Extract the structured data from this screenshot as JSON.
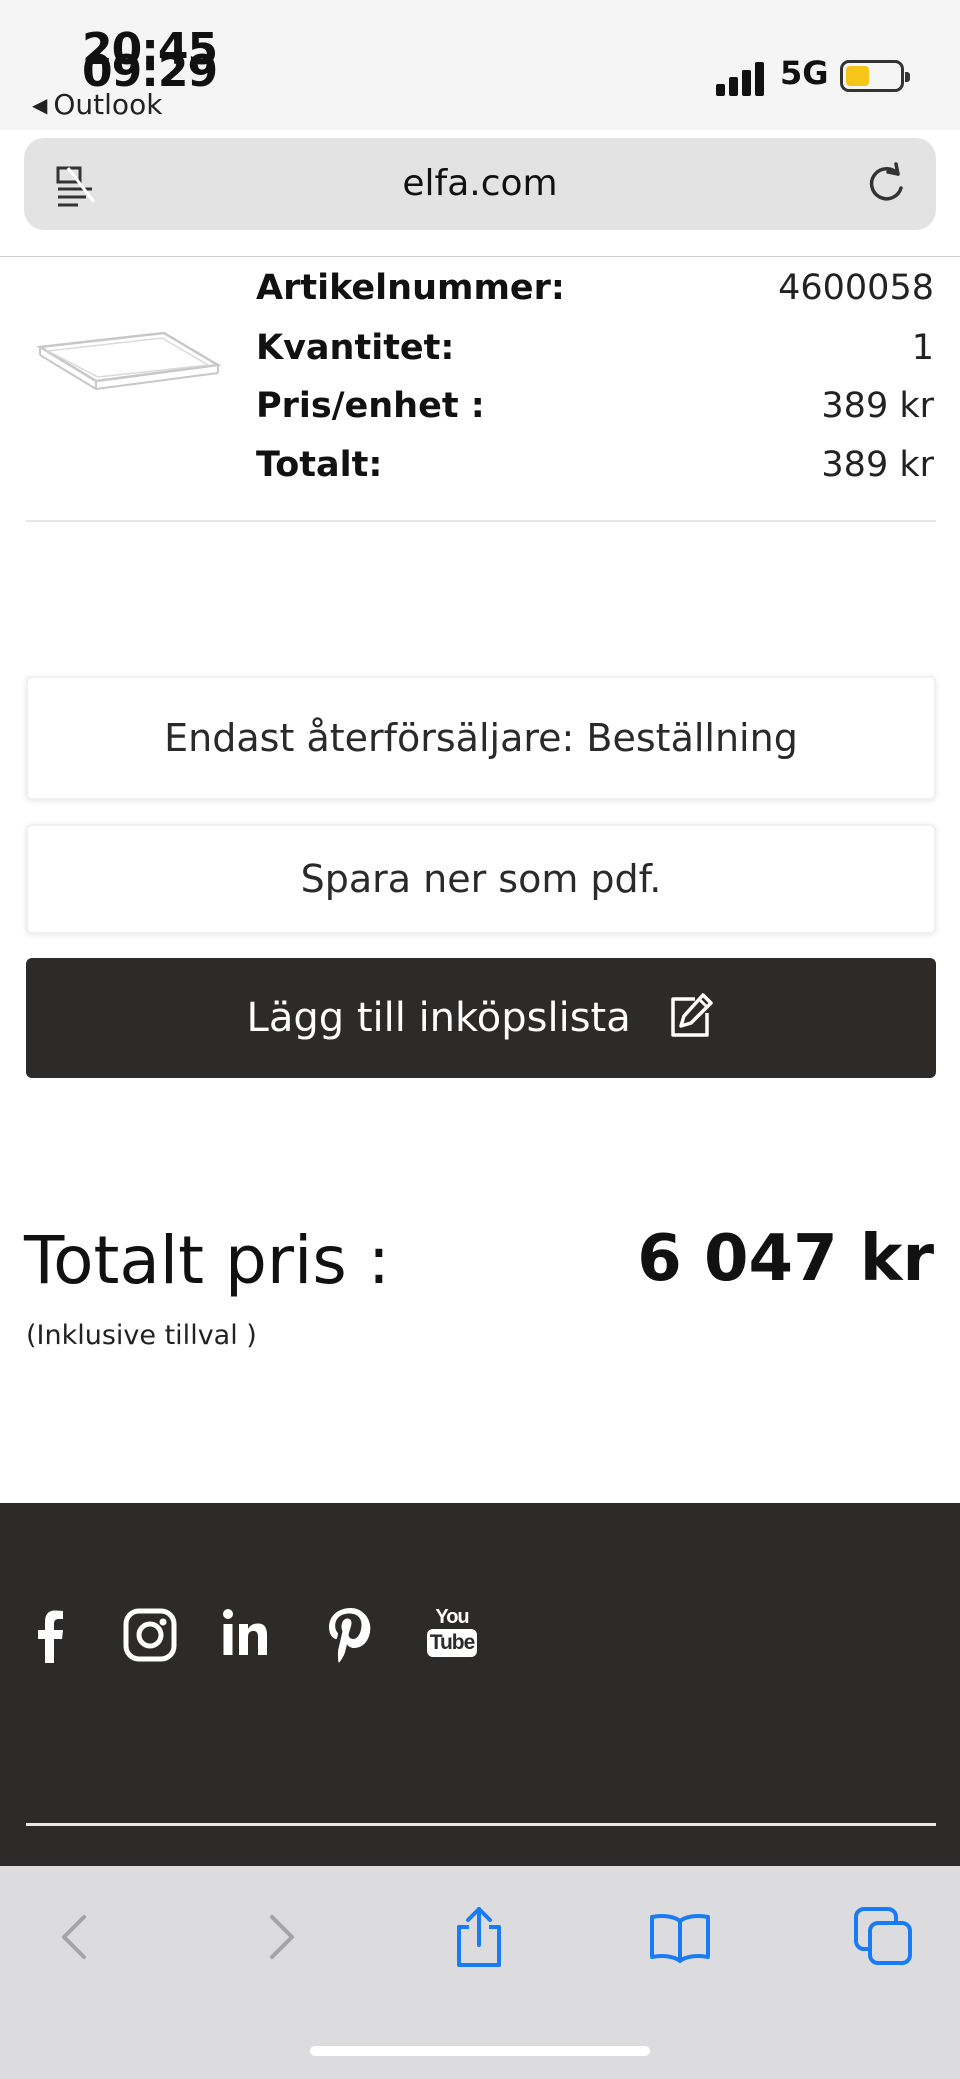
{
  "status_bar": {
    "time_primary": "20:45",
    "time_secondary": "09:29",
    "back_app": "Outlook",
    "network": "5G",
    "battery_level": 0.45
  },
  "browser": {
    "url": "elfa.com",
    "left_icon": "reader-icon",
    "reload_icon": "reload-icon"
  },
  "article": {
    "rows": [
      {
        "label": "Artikelnummer:",
        "value": "4600058"
      },
      {
        "label": "Kvantitet:",
        "value": "1"
      },
      {
        "label": "Pris/enhet :",
        "value": "389 kr"
      },
      {
        "label": "Totalt:",
        "value": "389 kr"
      }
    ]
  },
  "actions": {
    "reseller_order": "Endast återförsäljare: Beställning",
    "save_pdf": "Spara ner som pdf.",
    "add_to_list": "Lägg till inköpslista"
  },
  "summary": {
    "total_label": "Totalt pris :",
    "total_value": "6 047 kr",
    "note": "(Inklusive tillval )"
  },
  "footer": {
    "social": [
      "facebook-icon",
      "instagram-icon",
      "linkedin-icon",
      "pinterest-icon",
      "youtube-icon"
    ],
    "youtube_top": "You",
    "youtube_bottom": "Tube"
  },
  "colors": {
    "dark": "#2d2b2a",
    "ios_blue": "#1a7cf5",
    "battery": "#f5c518"
  }
}
